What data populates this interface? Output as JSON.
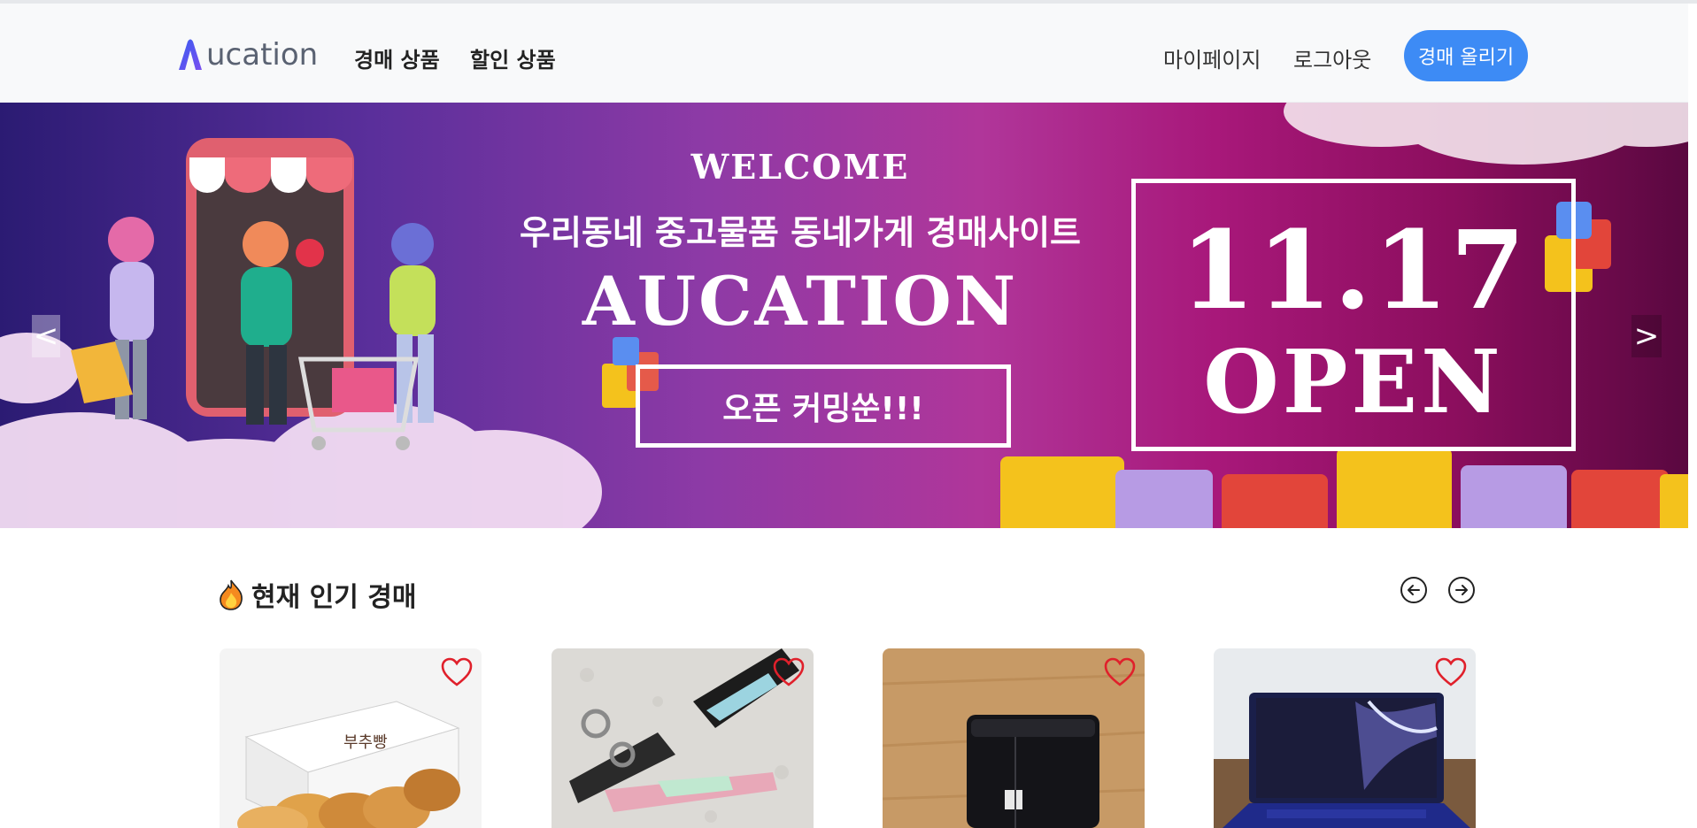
{
  "header": {
    "logo_text": "ucation",
    "nav": [
      "경매 상품",
      "할인 상품"
    ],
    "mypage": "마이페이지",
    "logout": "로그아웃",
    "upload_button": "경매 올리기"
  },
  "banner": {
    "welcome": "WELCOME",
    "subtitle": "우리동네 중고물품 동네가게 경매사이트",
    "brand": "AUCATION",
    "coming_soon": "오픈 커밍쑨!!!",
    "date": "11.17",
    "open": "OPEN",
    "prev": "<",
    "next": ">"
  },
  "popular": {
    "icon": "fire-icon",
    "title": "현재 인기 경매",
    "prev_icon": "arrow-left-circle-icon",
    "next_icon": "arrow-right-circle-icon",
    "items": [
      {
        "image": "bread-box-photo",
        "icon": "heart-outline-icon"
      },
      {
        "image": "keyrings-photo",
        "icon": "heart-outline-icon"
      },
      {
        "image": "black-wallet-photo",
        "icon": "heart-outline-icon"
      },
      {
        "image": "laptop-photo",
        "icon": "heart-outline-icon"
      }
    ]
  },
  "colors": {
    "accent": "#3d8bf5",
    "heart": "#e0202b",
    "banner_left": "#2b1b73",
    "banner_right": "#8c0e5e"
  }
}
